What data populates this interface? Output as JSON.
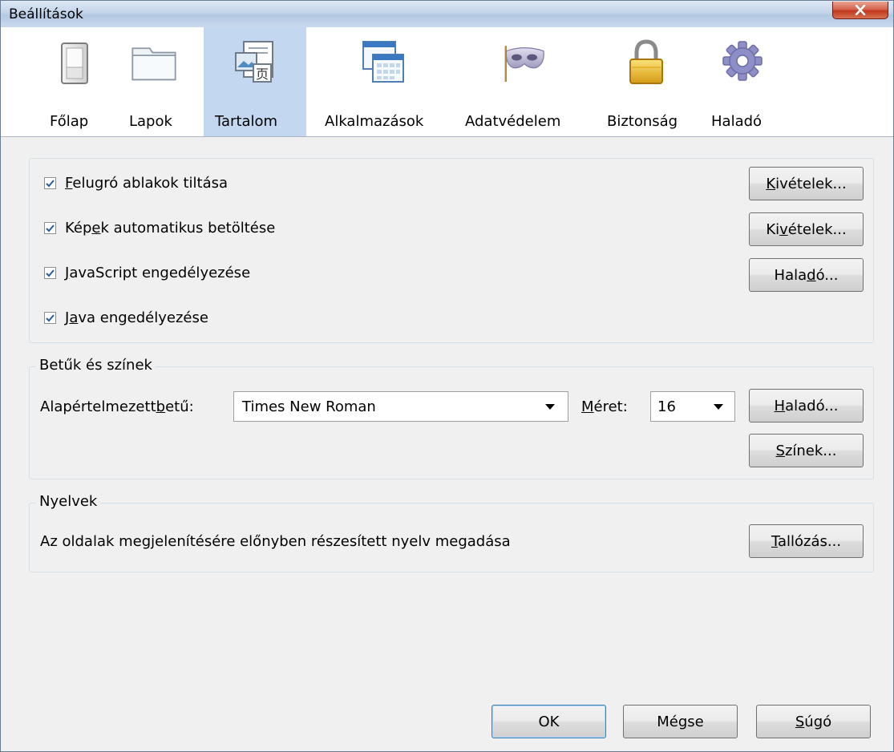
{
  "window": {
    "title": "Beállítások"
  },
  "tabs": [
    {
      "label": "Főlap",
      "icon": "main-page-icon"
    },
    {
      "label": "Lapok",
      "icon": "tabs-folder-icon"
    },
    {
      "label": "Tartalom",
      "icon": "content-icon",
      "selected": true
    },
    {
      "label": "Alkalmazások",
      "icon": "applications-icon"
    },
    {
      "label": "Adatvédelem",
      "icon": "privacy-mask-icon"
    },
    {
      "label": "Biztonság",
      "icon": "security-lock-icon"
    },
    {
      "label": "Haladó",
      "icon": "advanced-gear-icon"
    }
  ],
  "content": {
    "popup": {
      "pre": "",
      "u": "F",
      "post": "elugró ablakok tiltása",
      "checked": true,
      "button": {
        "pre": "",
        "u": "K",
        "post": "ivételek..."
      }
    },
    "images": {
      "pre": "Kép",
      "u": "e",
      "post": "k automatikus betöltése",
      "checked": true,
      "button": {
        "pre": "Ki",
        "u": "v",
        "post": "ételek..."
      }
    },
    "javascript": {
      "pre": "",
      "u": "J",
      "post": "avaScript engedélyezése",
      "checked": true,
      "button": {
        "pre": "Hala",
        "u": "d",
        "post": "ó..."
      }
    },
    "java": {
      "pre": "J",
      "u": "a",
      "post": "va engedélyezése",
      "checked": true
    }
  },
  "fonts": {
    "legend": "Betűk és színek",
    "default_font_label": {
      "pre": "Alapértelmezett ",
      "u": "b",
      "post": "etű:"
    },
    "default_font_value": "Times New Roman",
    "size_label": {
      "pre": "",
      "u": "M",
      "post": "éret:"
    },
    "size_value": "16",
    "advanced_button": {
      "pre": "",
      "u": "H",
      "post": "aladó..."
    },
    "colors_button": {
      "pre": "",
      "u": "S",
      "post": "zínek..."
    }
  },
  "languages": {
    "legend": "Nyelvek",
    "description": "Az oldalak megjelenítésére előnyben részesített nyelv megadása",
    "browse_button": {
      "pre": "",
      "u": "T",
      "post": "allózás..."
    }
  },
  "footer": {
    "ok": "OK",
    "cancel": "Mégse",
    "help": {
      "pre": "",
      "u": "S",
      "post": "úgó"
    }
  }
}
